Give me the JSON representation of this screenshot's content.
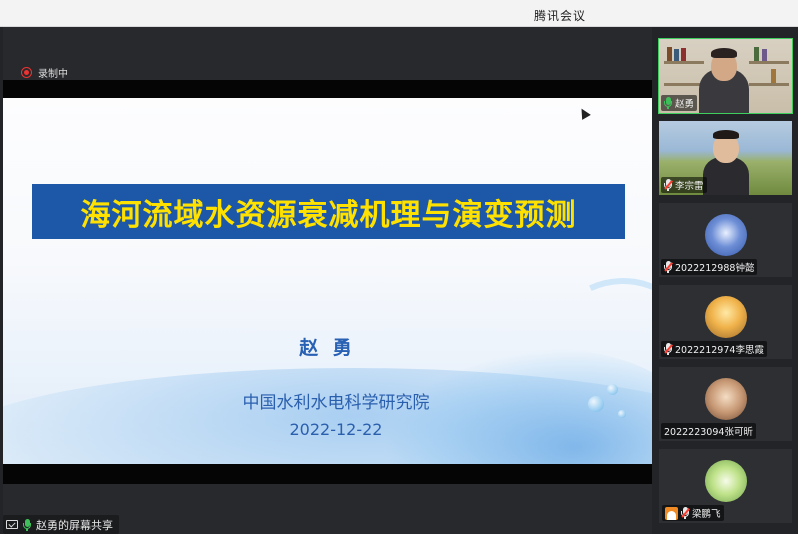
{
  "window": {
    "title": "腾讯会议"
  },
  "recording": {
    "label": "录制中",
    "icon": "record-icon"
  },
  "slide": {
    "title": "海河流域水资源衰减机理与演变预测",
    "presenter": "赵 勇",
    "institute": "中国水利水电科学研究院",
    "date": "2022-12-22",
    "accent": "#1d57a8",
    "title_color": "#ffe100"
  },
  "share_status": {
    "label": "赵勇的屏幕共享",
    "icon": "screen-share-icon"
  },
  "participants": [
    {
      "name": "赵勇",
      "mic": "active",
      "kind": "video"
    },
    {
      "name": "李宗雷",
      "mic": "muted",
      "kind": "video"
    },
    {
      "name": "2022212988钟懿",
      "mic": "muted",
      "kind": "avatar"
    },
    {
      "name": "2022212974李思霞",
      "mic": "muted",
      "kind": "avatar"
    },
    {
      "name": "2022223094张可昕",
      "mic": "none",
      "kind": "avatar"
    },
    {
      "name": "梁鹏飞",
      "mic": "muted",
      "kind": "avatar"
    }
  ]
}
